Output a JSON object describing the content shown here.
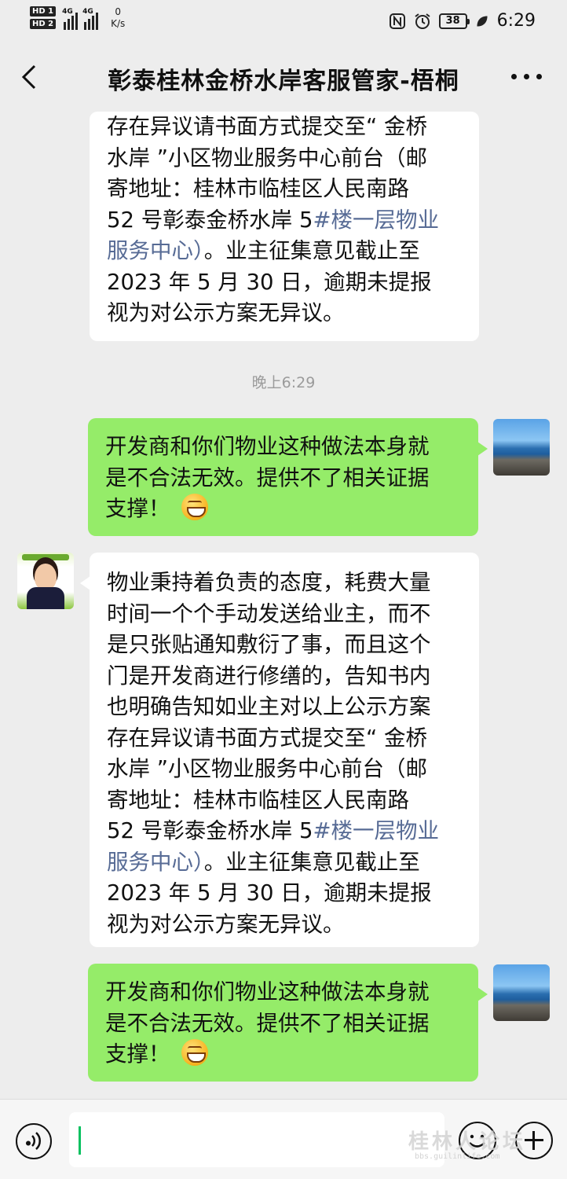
{
  "status_bar": {
    "sim1": "HD 1",
    "sim2": "HD 2",
    "network_type_1": "4G",
    "network_type_2": "4G",
    "speed_value": "0",
    "speed_unit": "K/s",
    "battery": "38",
    "time": "6:29"
  },
  "header": {
    "title": "彰泰桂林金桥水岸客服管家-梧桐"
  },
  "messages": [
    {
      "direction": "in",
      "lines": [
        "存在异议请书面方式提交至“ 金桥",
        "水岸 ”小区物业服务中心前台（邮",
        "寄地址：桂林市临桂区人民南路",
        "52 号彰泰金桥水岸 5",
        "服务中心）。业主征集意见截止至",
        "2023 年 5 月 30 日，逾期未提报",
        "视为对公示方案无异议。"
      ],
      "link_text": "#楼一层物业",
      "link_text_2": "服务中心）"
    },
    {
      "direction": "out",
      "lines": [
        "开发商和你们物业这种做法本身就",
        "是不合法无效。提供不了相关证据",
        "支撑！"
      ],
      "emoji": "grinning-face"
    },
    {
      "direction": "in",
      "lines": [
        "物业秉持着负责的态度，耗费大量",
        "时间一个个手动发送给业主，而不",
        "是只张贴通知敷衍了事，而且这个",
        "门是开发商进行修缮的，告知书内",
        "也明确告知如业主对以上公示方案",
        "存在异议请书面方式提交至“ 金桥",
        "水岸 ”小区物业服务中心前台（邮",
        "寄地址：桂林市临桂区人民南路",
        "52 号彰泰金桥水岸 5",
        "。业主征集意见截止至",
        "2023 年 5 月 30 日，逾期未提报",
        "视为对公示方案无异议。"
      ],
      "link_text": "#楼一层物业",
      "link_text_2": "服务中心）"
    },
    {
      "direction": "out",
      "lines": [
        "开发商和你们物业这种做法本身就",
        "是不合法无效。提供不了相关证据",
        "支撑！"
      ],
      "emoji": "grinning-face"
    }
  ],
  "timestamp": "晚上6:29",
  "input_bar": {
    "placeholder": ""
  },
  "watermark": {
    "text": "桂林人论坛",
    "sub": "bbs.guilinlife.com"
  },
  "colors": {
    "background": "#ededed",
    "outgoing_bubble": "#95ec69",
    "incoming_bubble": "#ffffff",
    "link": "#576b95",
    "cursor": "#07c160"
  },
  "icons": [
    "back-arrow-icon",
    "more-icon",
    "voice-icon",
    "emoji-icon",
    "plus-icon"
  ]
}
